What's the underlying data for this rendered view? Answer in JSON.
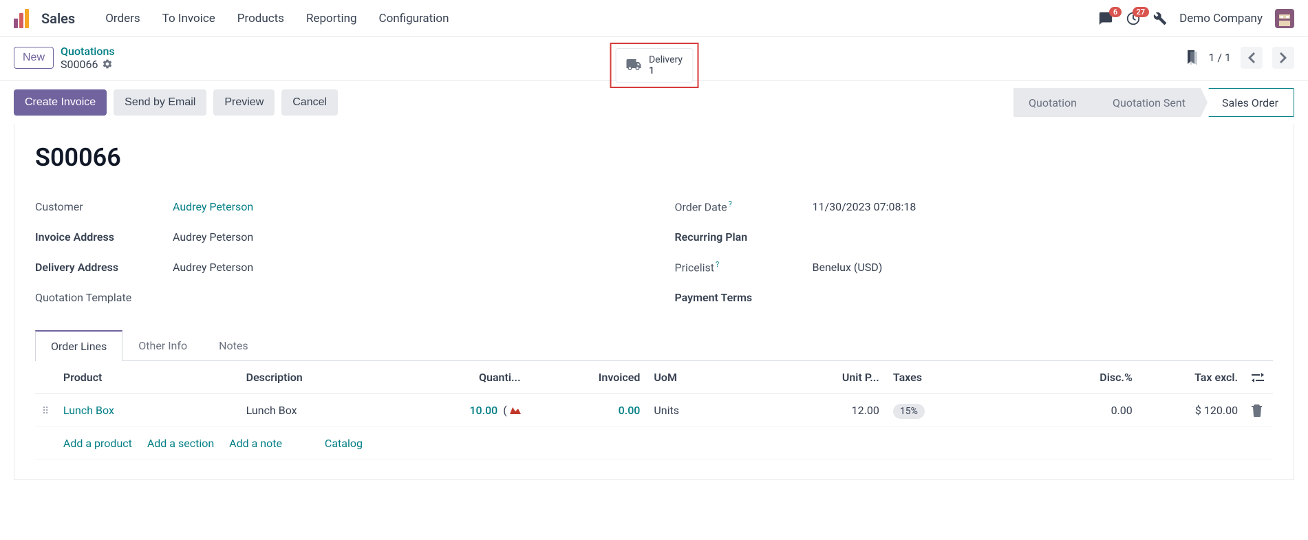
{
  "nav": {
    "app_name": "Sales",
    "items": [
      "Orders",
      "To Invoice",
      "Products",
      "Reporting",
      "Configuration"
    ],
    "messages_badge": "6",
    "activities_badge": "27",
    "company": "Demo Company"
  },
  "breadcrumb": {
    "new_label": "New",
    "parent": "Quotations",
    "current": "S00066",
    "stat_label": "Delivery",
    "stat_count": "1",
    "pager": "1 / 1"
  },
  "actions": {
    "create_invoice": "Create Invoice",
    "send_email": "Send by Email",
    "preview": "Preview",
    "cancel": "Cancel"
  },
  "status": {
    "quotation": "Quotation",
    "quotation_sent": "Quotation Sent",
    "sales_order": "Sales Order"
  },
  "record": {
    "title": "S00066",
    "labels": {
      "customer": "Customer",
      "invoice_address": "Invoice Address",
      "delivery_address": "Delivery Address",
      "quotation_template": "Quotation Template",
      "order_date": "Order Date",
      "recurring_plan": "Recurring Plan",
      "pricelist": "Pricelist",
      "payment_terms": "Payment Terms"
    },
    "values": {
      "customer": "Audrey Peterson",
      "invoice_address": "Audrey Peterson",
      "delivery_address": "Audrey Peterson",
      "order_date": "11/30/2023 07:08:18",
      "pricelist": "Benelux (USD)"
    }
  },
  "tabs": {
    "order_lines": "Order Lines",
    "other_info": "Other Info",
    "notes": "Notes"
  },
  "table": {
    "headers": {
      "product": "Product",
      "description": "Description",
      "quantity": "Quanti...",
      "invoiced": "Invoiced",
      "uom": "UoM",
      "unit_price": "Unit P...",
      "taxes": "Taxes",
      "disc": "Disc.%",
      "tax_excl": "Tax excl."
    },
    "row": {
      "product": "Lunch Box",
      "description": "Lunch Box",
      "quantity": "10.00",
      "invoiced": "0.00",
      "uom": "Units",
      "unit_price": "12.00",
      "taxes": "15%",
      "disc": "0.00",
      "tax_excl": "$ 120.00"
    },
    "add_links": {
      "add_product": "Add a product",
      "add_section": "Add a section",
      "add_note": "Add a note",
      "catalog": "Catalog"
    }
  }
}
